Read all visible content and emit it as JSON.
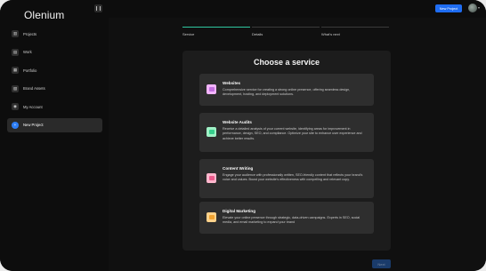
{
  "app": {
    "name": "Olenium"
  },
  "sidebar": {
    "items": [
      {
        "label": "Projects",
        "icon": "projects-icon",
        "glyph": "▥"
      },
      {
        "label": "Work",
        "icon": "work-icon",
        "glyph": "▤"
      },
      {
        "label": "Portfolio",
        "icon": "portfolio-icon",
        "glyph": "▦"
      },
      {
        "label": "Brand Assets",
        "icon": "brand-assets-icon",
        "glyph": "▧"
      },
      {
        "label": "My Account",
        "icon": "account-icon",
        "glyph": "◉"
      },
      {
        "label": "New Project",
        "icon": "plus-icon",
        "glyph": "+"
      }
    ]
  },
  "topbar": {
    "new_project_label": "New Project"
  },
  "stepper": {
    "steps": [
      {
        "label": "Service"
      },
      {
        "label": "Details"
      },
      {
        "label": "What's next"
      }
    ]
  },
  "panel": {
    "title": "Choose a service",
    "services": [
      {
        "title": "Websites",
        "description": "Comprehensive service for creating a strong online presence, offering seamless design, development, hosting, and deployment solutions.",
        "icon": "website-icon",
        "color": "#c46fe0"
      },
      {
        "title": "Website Audits",
        "description": "Receive a detailed analysis of your current website, identifying areas for improvement in performance, design, SEO, and compliance. Optimize your site to enhance user experience and achieve better results.",
        "icon": "audit-icon",
        "color": "#36cf8c"
      },
      {
        "title": "Content Writing",
        "description": "Engage your audience with professionally written, SEO-friendly content that reflects your brand's voice and values. Boost your website's effectiveness with compelling and relevant copy.",
        "icon": "writing-icon",
        "color": "#ec5b8c"
      },
      {
        "title": "Digital Marketing",
        "description": "Elevate your online presence through strategic, data-driven campaigns. Experts in SEO, social media, and email marketing to expand your brand",
        "icon": "marketing-icon",
        "color": "#f0a230"
      }
    ]
  },
  "footer": {
    "next_label": "Next"
  },
  "colors": {
    "accent": "#1f6df2",
    "step_active": "#2fc7a1"
  }
}
